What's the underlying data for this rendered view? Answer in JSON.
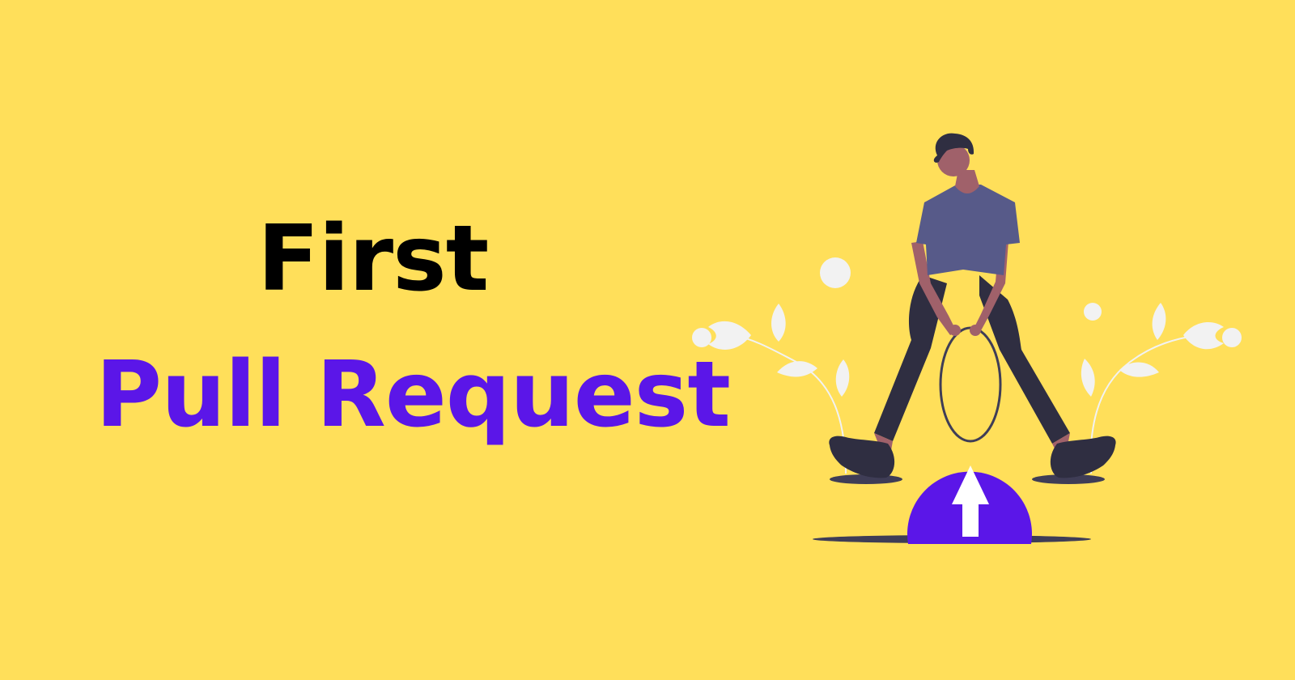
{
  "banner": {
    "title_line_1": "First",
    "title_line_2": "Pull Request"
  },
  "colors": {
    "background": "#FFDF5A",
    "title_line_1": "#000000",
    "title_line_2": "#5B16E8",
    "accent_purple": "#5B16E8",
    "shirt": "#575A89",
    "pants": "#2F2E41",
    "skin": "#A0616A",
    "hair": "#2F2E41",
    "leaves": "#F2F2F2",
    "shadow": "#3F3D56",
    "arrow": "#FFFFFF"
  },
  "illustration": {
    "icons": [
      "person-figure",
      "up-arrow-icon",
      "plant-left",
      "plant-right"
    ]
  }
}
